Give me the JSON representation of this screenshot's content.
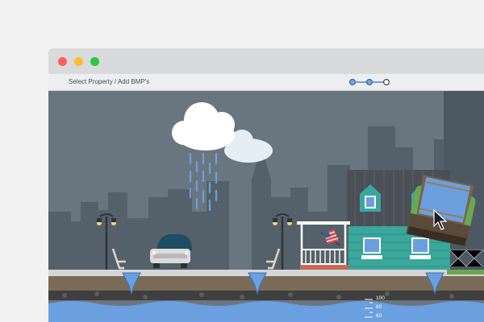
{
  "window": {
    "controls": [
      "close",
      "minimize",
      "maximize"
    ],
    "colors": {
      "close": "#ff5f57",
      "minimize": "#febc2e",
      "maximize": "#28c840"
    }
  },
  "toolbar": {
    "breadcrumb": "Select Property / Add BMP's",
    "steps": [
      {
        "state": "completed"
      },
      {
        "state": "current"
      },
      {
        "state": "upcoming"
      }
    ]
  },
  "scene": {
    "weather": "rain-cloud",
    "flag": "us-flag",
    "depth_gauge": {
      "labels": [
        "100",
        "80",
        "60"
      ]
    }
  },
  "colors": {
    "sky": "#6a767f",
    "skyline": "#54616a",
    "water": "#6a9fe0",
    "house": "#3aa79b",
    "accent": "#3b6fb6"
  }
}
